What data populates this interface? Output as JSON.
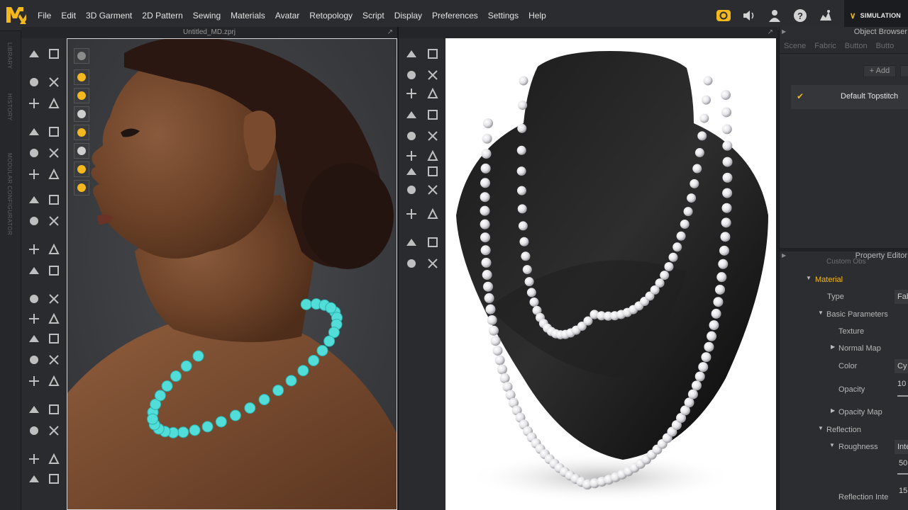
{
  "app": {
    "logo_letters": "MD",
    "menus": [
      "File",
      "Edit",
      "3D Garment",
      "2D Pattern",
      "Sewing",
      "Materials",
      "Avatar",
      "Retopology",
      "Script",
      "Display",
      "Preferences",
      "Settings",
      "Help"
    ],
    "mode_label": "SIMULATION",
    "accent": "#f2b81e"
  },
  "left_strip": {
    "tabs": [
      "LIBRARY",
      "HISTORY",
      "MODULAR CONFIGURATOR"
    ]
  },
  "window3d": {
    "title": "Untitled_MD.zprj"
  },
  "right_panel": {
    "object_browser_title": "Object Browser",
    "tabs": [
      "Scene",
      "Fabric",
      "Button",
      "Butto"
    ],
    "add_label": "+ Add",
    "item_label": "Default Topstitch",
    "property_editor_title": "Property Editor",
    "cut_label": "Custom Obs",
    "properties": {
      "material": "Material",
      "type_label": "Type",
      "type_value": "Fab",
      "basic_params": "Basic Parameters",
      "texture": "Texture",
      "normal_map": "Normal Map",
      "color_label": "Color",
      "color_value": "Cy",
      "opacity_label": "Opacity",
      "opacity_value": "10",
      "opacity_map": "Opacity Map",
      "reflection": "Reflection",
      "roughness_label": "Roughness",
      "roughness_value": "Inte",
      "roughness_number": "50",
      "reflection_intensity_label": "Reflection Inte",
      "reflection_intensity_value": "15"
    }
  },
  "colors": {
    "bead_3d": "#52ddd9",
    "bust": "#0b0b0b",
    "pearl": "#e9e9ec"
  }
}
